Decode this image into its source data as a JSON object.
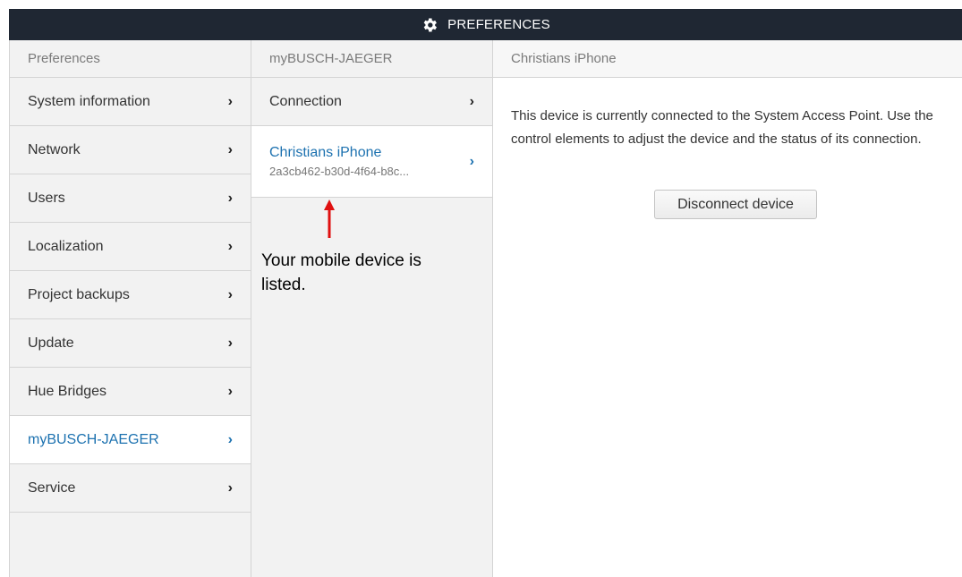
{
  "window": {
    "title": "PREFERENCES",
    "icon": "gear-icon"
  },
  "left_panel": {
    "header": "Preferences",
    "items": [
      {
        "label": "System information",
        "active": false
      },
      {
        "label": "Network",
        "active": false
      },
      {
        "label": "Users",
        "active": false
      },
      {
        "label": "Localization",
        "active": false
      },
      {
        "label": "Project backups",
        "active": false
      },
      {
        "label": "Update",
        "active": false
      },
      {
        "label": "Hue Bridges",
        "active": false
      },
      {
        "label": "myBUSCH-JAEGER",
        "active": true
      },
      {
        "label": "Service",
        "active": false
      }
    ]
  },
  "mid_panel": {
    "header": "myBUSCH-JAEGER",
    "connection_label": "Connection",
    "device": {
      "name": "Christians iPhone",
      "id": "2a3cb462-b30d-4f64-b8c..."
    }
  },
  "annotation": {
    "text": "Your mobile device is listed."
  },
  "right_panel": {
    "header": "Christians iPhone",
    "description": "This device is currently connected to the System Access Point. Use the control elements to adjust the device and the status of its connection.",
    "button_label": "Disconnect device"
  },
  "colors": {
    "titlebar": "#1f2733",
    "accent": "#1d72b0",
    "annotation_arrow": "#e01010"
  }
}
